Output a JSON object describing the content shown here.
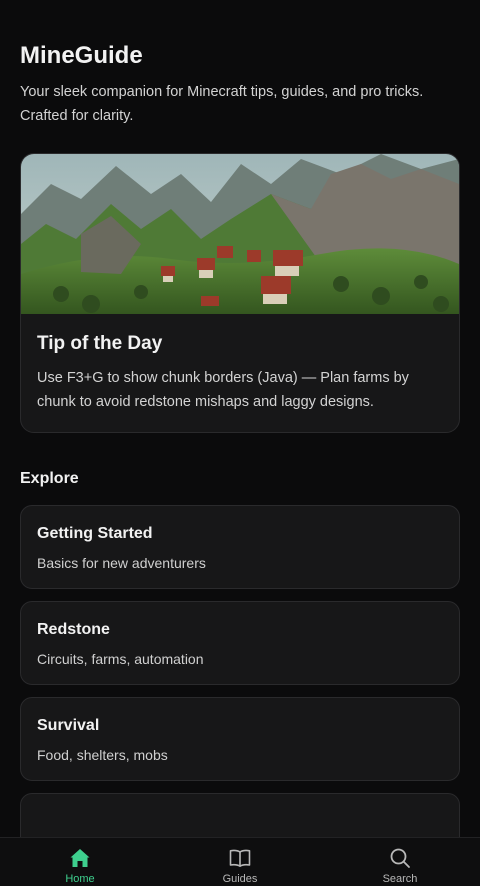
{
  "header": {
    "title": "MineGuide",
    "subtitle": "Your sleek companion for Minecraft tips, guides, and pro tricks. Crafted for clarity."
  },
  "tip": {
    "title": "Tip of the Day",
    "text": "Use F3+G to show chunk borders (Java) — Plan farms by chunk to avoid redstone mishaps and laggy designs."
  },
  "explore": {
    "title": "Explore",
    "items": [
      {
        "title": "Getting Started",
        "desc": "Basics for new adventurers"
      },
      {
        "title": "Redstone",
        "desc": "Circuits, farms, automation"
      },
      {
        "title": "Survival",
        "desc": "Food, shelters, mobs"
      }
    ]
  },
  "nav": {
    "items": [
      {
        "label": "Home",
        "icon": "home-icon",
        "active": true
      },
      {
        "label": "Guides",
        "icon": "book-icon",
        "active": false
      },
      {
        "label": "Search",
        "icon": "search-icon",
        "active": false
      }
    ]
  },
  "colors": {
    "background": "#0b0b0c",
    "card": "#171718",
    "accent": "#3ecf8e"
  }
}
